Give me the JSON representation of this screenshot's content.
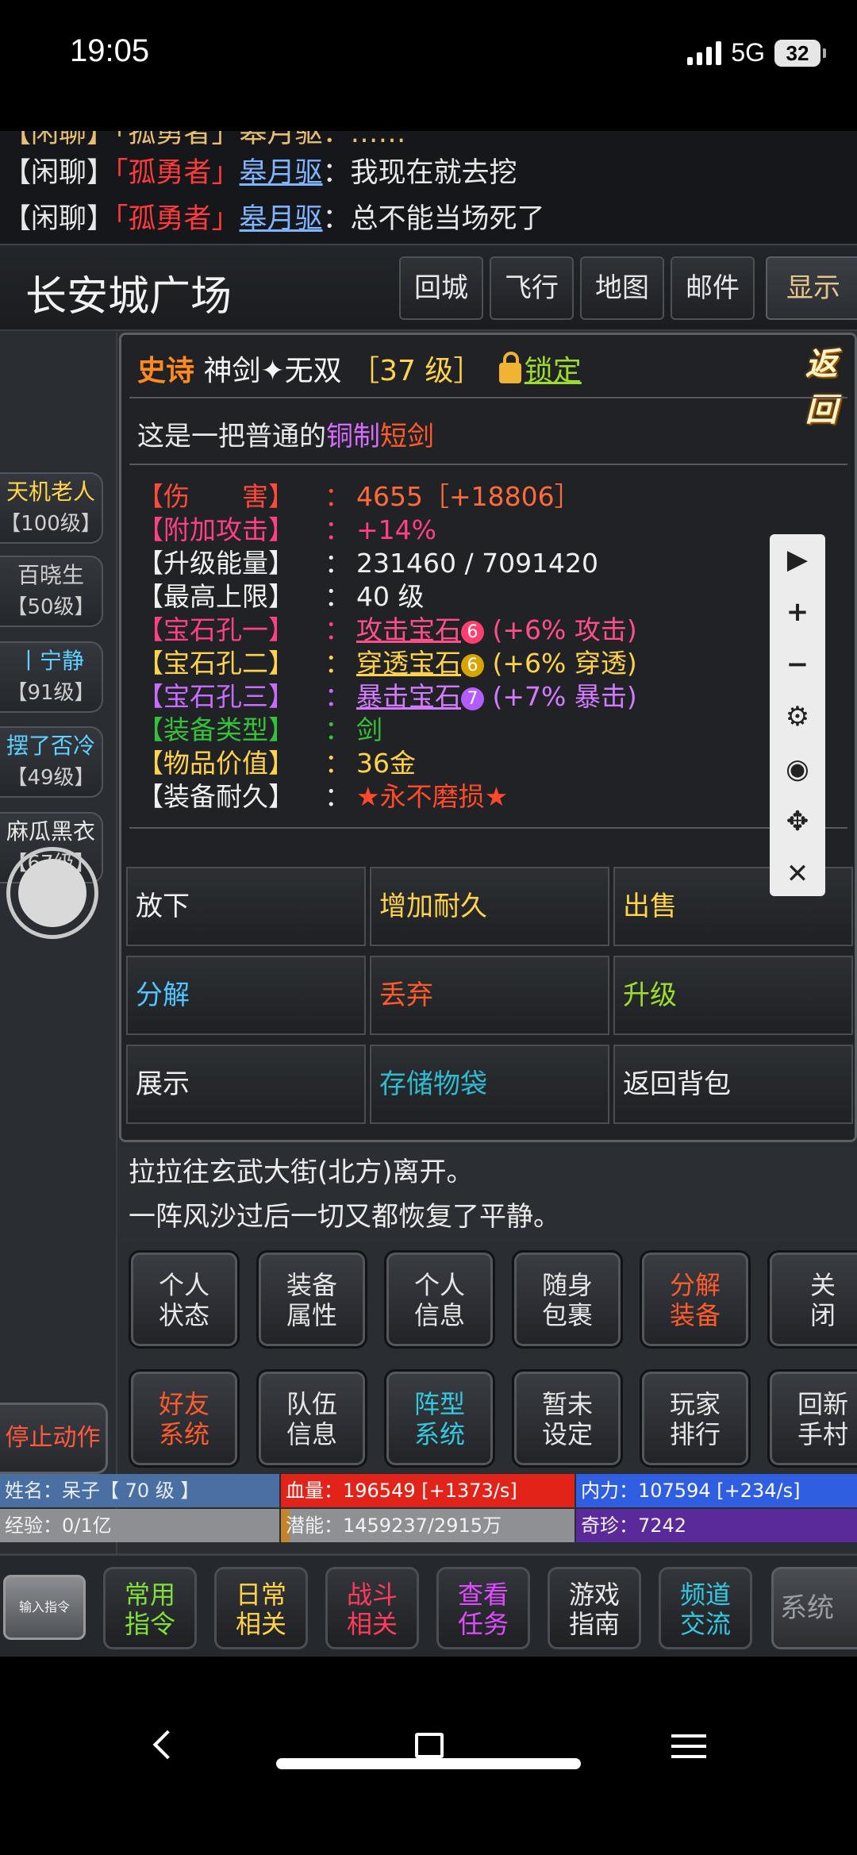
{
  "status_bar": {
    "time": "19:05",
    "network": "5G",
    "battery": "32"
  },
  "chat": {
    "cut_line": "【闲聊】「孤勇者」皋月驱：……",
    "lines": [
      {
        "channel": "【闲聊】",
        "tag": "「孤勇者」",
        "user": "皋月驱",
        "msg": "：我现在就去挖"
      },
      {
        "channel": "【闲聊】",
        "tag": "「孤勇者」",
        "user": "皋月驱",
        "msg": "：总不能当场死了"
      }
    ]
  },
  "location": {
    "name": "长安城广场",
    "buttons": [
      "回城",
      "飞行",
      "地图",
      "邮件",
      "显示"
    ]
  },
  "npcs": [
    {
      "name": "天机老人",
      "level": "【100级】",
      "color": "#ffd34a"
    },
    {
      "name": "百晓生",
      "level": "【50级】",
      "color": "#cfcfcf"
    },
    {
      "name": "丨宁静",
      "level": "【91级】",
      "color": "#5fd0ff"
    },
    {
      "name": "摆了否冷",
      "level": "【49级】",
      "color": "#5fd0ff"
    },
    {
      "name": "麻瓜黑衣",
      "level": "【67级】",
      "color": "#e8e8e8"
    }
  ],
  "item": {
    "rarity": "史诗",
    "name": "神剑✦无双",
    "level": "［37 级］",
    "lock_label": "锁定",
    "back_badge": "返回",
    "desc": {
      "a": "这是一把普通的",
      "b": "铜制",
      "c": "短剑"
    },
    "stats": [
      {
        "key": "【伤　　害】",
        "sep": "：",
        "val": "4655［+18806］",
        "kc": "#ff4a3a",
        "vc": "#ff6a3a"
      },
      {
        "key": "【附加攻击】",
        "sep": "：",
        "val": "+14%",
        "kc": "#ff3f86",
        "vc": "#ff3f86"
      },
      {
        "key": "【升级能量】",
        "sep": "：",
        "val": "231460 / 7091420",
        "kc": "#f0f0f0",
        "vc": "#f0f0f0"
      },
      {
        "key": "【最高上限】",
        "sep": "：",
        "val": "40 级",
        "kc": "#f0f0f0",
        "vc": "#f0f0f0"
      },
      {
        "key": "【宝石孔一】",
        "sep": "：",
        "val": "攻击宝石",
        "gem": "6",
        "gemc": "#ff3f6e",
        "extra": " (+6% 攻击)",
        "kc": "#ff3f86",
        "vc": "#ff4f8a"
      },
      {
        "key": "【宝石孔二】",
        "sep": "：",
        "val": "穿透宝石",
        "gem": "6",
        "gemc": "#d8a400",
        "extra": " (+6% 穿透)",
        "kc": "#ffd24a",
        "vc": "#ffd24a"
      },
      {
        "key": "【宝石孔三】",
        "sep": "：",
        "val": "暴击宝石",
        "gem": "7",
        "gemc": "#b35cff",
        "extra": " (+7% 暴击)",
        "kc": "#c86bff",
        "vc": "#d27bff"
      },
      {
        "key": "【装备类型】",
        "sep": "：",
        "val": "剑",
        "kc": "#35c23a",
        "vc": "#35c23a"
      },
      {
        "key": "【物品价值】",
        "sep": "：",
        "val": "36金",
        "kc": "#ffd24a",
        "vc": "#ffd24a"
      },
      {
        "key": "【装备耐久】",
        "sep": "：",
        "val": "★永不磨损★",
        "kc": "#f0f0f0",
        "vc": "#ff4a2a"
      }
    ],
    "actions": [
      {
        "label": "放下",
        "color": "#f0f0f0"
      },
      {
        "label": "增加耐久",
        "color": "#ffd24a"
      },
      {
        "label": "出售",
        "color": "#ffd24a"
      },
      {
        "label": "分解",
        "color": "#4fc6ff"
      },
      {
        "label": "丢弃",
        "color": "#ff5a2a"
      },
      {
        "label": "升级",
        "color": "#9ddc2c"
      },
      {
        "label": "展示",
        "color": "#f0f0f0"
      },
      {
        "label": "存储物袋",
        "color": "#2fbad0"
      },
      {
        "label": "返回背包",
        "color": "#f0f0f0"
      }
    ]
  },
  "toolbar_icons": [
    "play-icon",
    "plus-icon",
    "minus-icon",
    "gear-icon",
    "eye-icon",
    "move-icon",
    "close-icon"
  ],
  "log": [
    "拉拉往玄武大街(北方)离开。",
    "一阵风沙过后一切又都恢复了平静。"
  ],
  "menu": [
    {
      "l1": "个人",
      "l2": "状态",
      "style": ""
    },
    {
      "l1": "装备",
      "l2": "属性",
      "style": ""
    },
    {
      "l1": "个人",
      "l2": "信息",
      "style": ""
    },
    {
      "l1": "随身",
      "l2": "包裹",
      "style": ""
    },
    {
      "l1": "分解",
      "l2": "装备",
      "style": "red"
    },
    {
      "l1": "关",
      "l2": "闭",
      "style": ""
    },
    {
      "l1": "好友",
      "l2": "系统",
      "style": "red"
    },
    {
      "l1": "队伍",
      "l2": "信息",
      "style": ""
    },
    {
      "l1": "阵型",
      "l2": "系统",
      "style": "cyan"
    },
    {
      "l1": "暂未",
      "l2": "设定",
      "style": ""
    },
    {
      "l1": "玩家",
      "l2": "排行",
      "style": ""
    },
    {
      "l1": "回新",
      "l2": "手村",
      "style": ""
    }
  ],
  "stop_action": "停止动作",
  "player": {
    "name": "姓名：呆子【 70 级 】",
    "hp": "血量：196549 [+1373/s]",
    "mp": "内力：107594 [+234/s]",
    "exp": "经验：0/1亿",
    "potential": "潜能：1459237/2915万",
    "treasure": "奇珍：7242",
    "hp_color": "#e2231a",
    "mp_color": "#2f5fe0"
  },
  "commands": {
    "input_label": "输入指令",
    "buttons": [
      {
        "l1": "常用",
        "l2": "指令",
        "color": "#7fe03a"
      },
      {
        "l1": "日常",
        "l2": "相关",
        "color": "#ffd24a"
      },
      {
        "l1": "战斗",
        "l2": "相关",
        "color": "#ff3a5a"
      },
      {
        "l1": "查看",
        "l2": "任务",
        "color": "#e04bff"
      },
      {
        "l1": "游戏",
        "l2": "指南",
        "color": "#e8e8e8"
      },
      {
        "l1": "频道",
        "l2": "交流",
        "color": "#34c7e0"
      }
    ],
    "system_label": "系统"
  }
}
